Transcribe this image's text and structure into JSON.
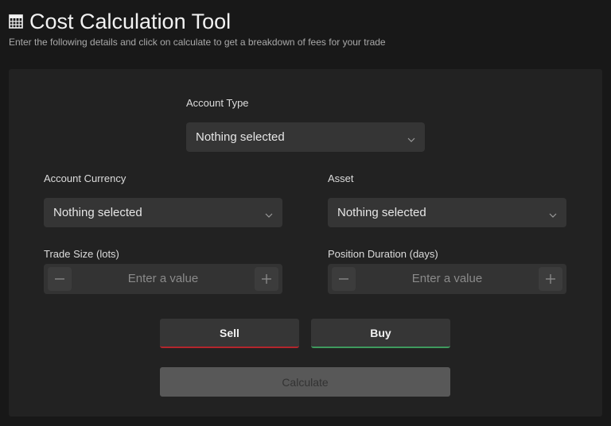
{
  "header": {
    "icon": "calculator-icon",
    "title": "Cost Calculation Tool",
    "subtitle": "Enter the following details and click on calculate to get a breakdown of fees for your trade"
  },
  "form": {
    "account_type": {
      "label": "Account Type",
      "value": "Nothing selected"
    },
    "account_currency": {
      "label": "Account Currency",
      "value": "Nothing selected"
    },
    "asset": {
      "label": "Asset",
      "value": "Nothing selected"
    },
    "trade_size": {
      "label": "Trade Size (lots)",
      "placeholder": "Enter a value"
    },
    "position_duration": {
      "label": "Position Duration (days)",
      "placeholder": "Enter a value"
    },
    "sell_label": "Sell",
    "buy_label": "Buy",
    "calculate_label": "Calculate"
  },
  "colors": {
    "sell_accent": "#b3262c",
    "buy_accent": "#3f9a5e"
  }
}
